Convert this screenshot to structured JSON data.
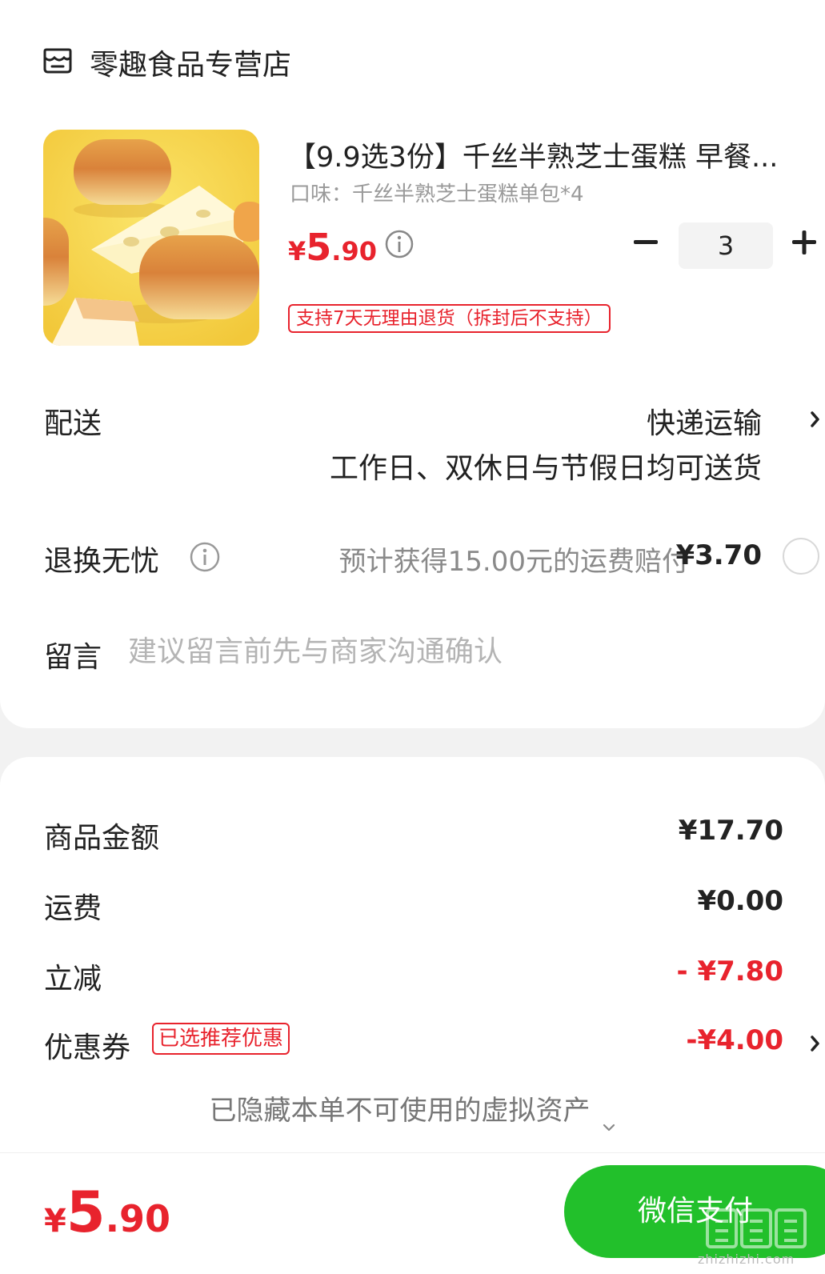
{
  "store": {
    "name": "零趣食品专营店",
    "icon": "store-icon"
  },
  "product": {
    "title": "【9.9选3份】千丝半熟芝士蛋糕 早餐...",
    "variant": "口味：千丝半熟芝士蛋糕单包*4",
    "price_currency": "¥",
    "price_int": "5",
    "price_dec": ".90",
    "quantity": "3",
    "return_policy_tag": "支持7天无理由退货（拆封后不支持）"
  },
  "delivery": {
    "label": "配送",
    "method": "快递运输",
    "note": "工作日、双休日与节假日均可送货"
  },
  "insurance": {
    "label": "退换无忧",
    "description": "预计获得15.00元的运费赔付",
    "price": "¥3.70",
    "selected": false
  },
  "message": {
    "label": "留言",
    "placeholder": "建议留言前先与商家沟通确认"
  },
  "summary": {
    "goods_label": "商品金额",
    "goods_value": "¥17.70",
    "shipping_label": "运费",
    "shipping_value": "¥0.00",
    "discount_label": "立减",
    "discount_value": "- ¥7.80",
    "coupon_label": "优惠券",
    "coupon_tag": "已选推荐优惠",
    "coupon_value": "-¥4.00",
    "hidden_assets": "已隐藏本单不可使用的虚拟资产"
  },
  "footer": {
    "total_currency": "¥",
    "total_int": "5",
    "total_dec": ".90",
    "pay_label": "微信支付",
    "watermark": "zhizhizhi.com"
  },
  "colors": {
    "accent_red": "#e8232d",
    "pay_green": "#22c02b",
    "background": "#f2f2f2"
  }
}
